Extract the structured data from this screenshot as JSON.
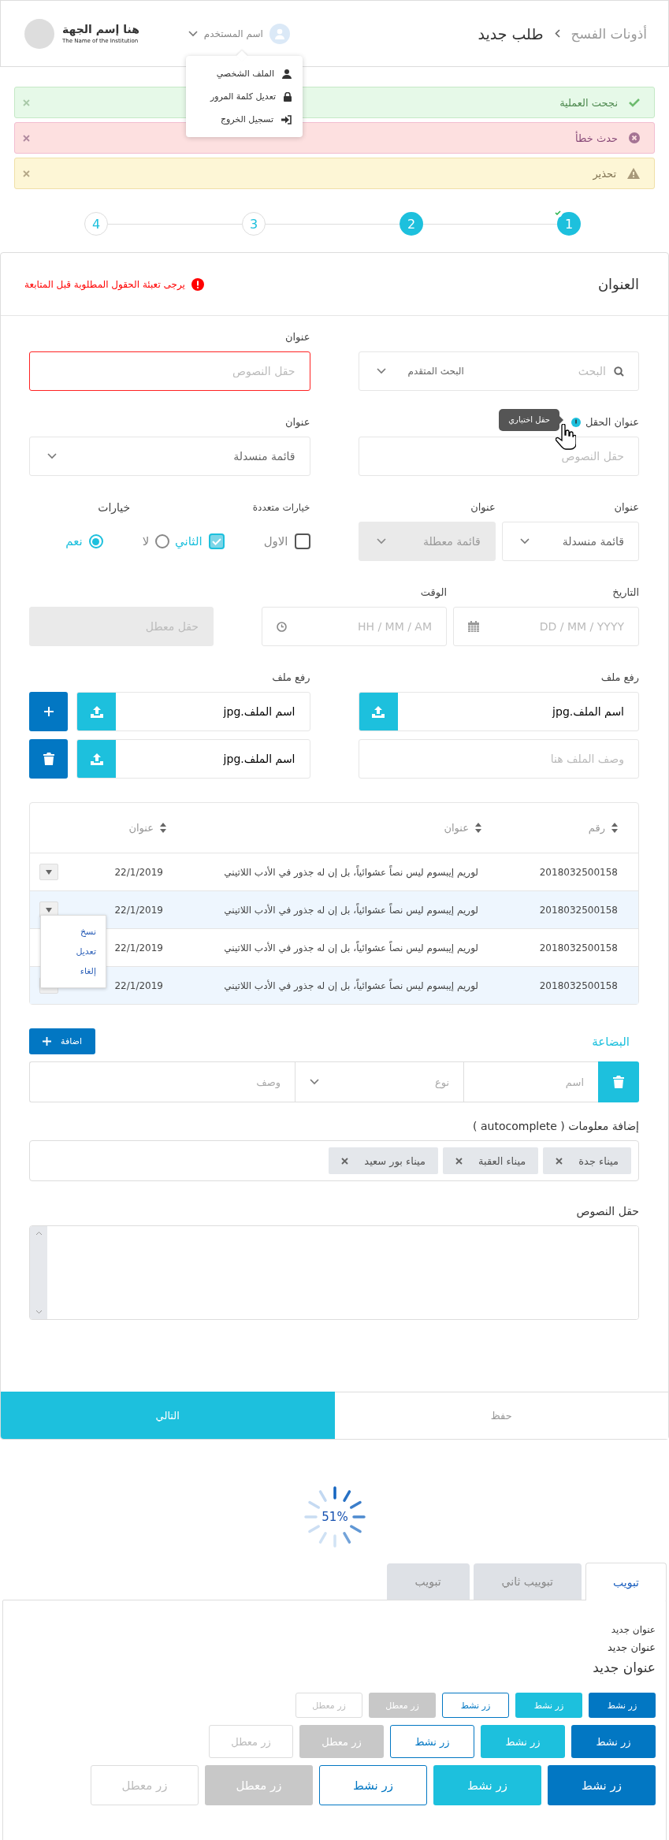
{
  "header": {
    "breadcrumb": [
      "أذونات الفسح",
      "طلب جديد"
    ],
    "user": "اسم المستخدم",
    "logo_title": "هنا إسم الجهة",
    "logo_subtitle": "The Name of the Institution"
  },
  "user_menu": [
    {
      "kind": "profile",
      "label": "الملف الشخصي"
    },
    {
      "kind": "lock",
      "label": "تعديل كلمة المرور"
    },
    {
      "kind": "logout",
      "label": "تسجيل الخروج"
    }
  ],
  "alerts": [
    {
      "kind": "success",
      "text": "نجحت العملية"
    },
    {
      "kind": "error",
      "text": "حدث خطأ"
    },
    {
      "kind": "warning",
      "text": "تحذير"
    }
  ],
  "stepper": [
    {
      "label": "1",
      "active": true,
      "completed": true
    },
    {
      "label": "2",
      "active": true,
      "completed": false
    },
    {
      "label": "3",
      "active": false,
      "completed": false
    },
    {
      "label": "4",
      "active": false,
      "completed": false
    }
  ],
  "form": {
    "title": "العنوان",
    "error": "يرجى تعبئة الحقول المطلوبة قبل المتابعة",
    "search": {
      "placeholder": "البحث",
      "filter": "البحث المتقدم"
    },
    "text_field": {
      "label": "عنوان",
      "placeholder": "حقل النصوص",
      "invalid": true
    },
    "optional_field": {
      "label": "عنوان الحقل",
      "tooltip": "حقل اختياري",
      "placeholder": "حقل النصوص"
    },
    "dropdown_1": {
      "label": "عنوان",
      "value": "قائمة منسدلة",
      "disabled": false
    },
    "dropdown_2": {
      "label": "عنوان",
      "value": "قائمة منسدلة",
      "disabled": false
    },
    "dropdown_3": {
      "label": "عنوان",
      "value": "قائمة معطلة",
      "disabled": true
    },
    "checkboxes": {
      "label": "خيارات متعددة",
      "options": [
        {
          "label": "الاول",
          "checked": false
        },
        {
          "label": "الثاني",
          "checked": true
        }
      ]
    },
    "radios": {
      "label": "خيارات",
      "options": [
        {
          "label": "لا",
          "selected": false
        },
        {
          "label": "نعم",
          "selected": true
        }
      ]
    },
    "date": {
      "label": "التاريخ",
      "placeholder": "DD / MM / YYYY"
    },
    "time": {
      "label": "الوقت",
      "placeholder": "HH / MM / AM"
    },
    "disabled_field": {
      "placeholder": "حقل معطل",
      "disabled": true
    },
    "upload": {
      "label": "رفع ملف",
      "file": "اسم الملف.jpg",
      "description_placeholder": "وصف الملف هنا"
    },
    "uploads": {
      "label": "رفع ملف",
      "files": [
        {
          "name": "اسم الملف.jpg",
          "kind": "add"
        },
        {
          "name": "اسم الملف.jpg",
          "kind": "delete"
        }
      ]
    },
    "table": {
      "columns": [
        {
          "label": "رقم",
          "sortable": true
        },
        {
          "label": "عنوان",
          "sortable": true
        },
        {
          "label": "عنوان",
          "sortable": true
        }
      ],
      "rows": [
        {
          "cells": [
            "2018032500158",
            "لوريم إيبسوم ليس نصاً عشوائياً، بل إن له جذور في الأدب اللاتيني",
            "22/1/2019"
          ],
          "highlighted": false,
          "menu_open": false
        },
        {
          "cells": [
            "2018032500158",
            "لوريم إيبسوم ليس نصاً عشوائياً، بل إن له جذور في الأدب اللاتيني",
            "22/1/2019"
          ],
          "highlighted": true,
          "menu_open": true
        },
        {
          "cells": [
            "2018032500158",
            "لوريم إيبسوم ليس نصاً عشوائياً، بل إن له جذور في الأدب اللاتيني",
            "22/1/2019"
          ],
          "highlighted": false,
          "menu_open": false
        },
        {
          "cells": [
            "2018032500158",
            "لوريم إيبسوم ليس نصاً عشوائياً، بل إن له جذور في الأدب اللاتيني",
            "22/1/2019"
          ],
          "highlighted": true,
          "menu_open": false
        }
      ],
      "row_menu": [
        "نسخ",
        "تعديل",
        "إلغاء"
      ]
    },
    "goods": {
      "title": "البضاعة",
      "add_button": "اضافة",
      "name_placeholder": "اسم",
      "type_placeholder": "نوع",
      "description_placeholder": "وصف"
    },
    "tags": {
      "label": "إضافة معلومات ( autocomplete )",
      "items": [
        "ميناء جدة",
        "ميناء العقبة",
        "ميناء بور سعيد"
      ]
    },
    "textarea": {
      "label": "حقل النصوص"
    },
    "footer": {
      "next": "التالي",
      "save": "حفظ"
    }
  },
  "spinner": {
    "label": "51%",
    "level": 0.51
  },
  "tabs": [
    {
      "label": "تبويب",
      "selected": true
    },
    {
      "label": "تبوييب ثاني",
      "selected": false
    },
    {
      "label": "تبويب",
      "selected": false
    }
  ],
  "panel": {
    "headings": [
      {
        "text": "عنوان جديد",
        "kind": "small"
      },
      {
        "text": "عنوان جديد",
        "kind": "medium"
      },
      {
        "text": "عنوان جديد",
        "kind": "large"
      }
    ],
    "button_rows": [
      {
        "kind": "small",
        "buttons": [
          {
            "label": "زر نشط",
            "kind": "primary"
          },
          {
            "label": "زر نشط",
            "kind": "secondary"
          },
          {
            "label": "زر نشط",
            "kind": "outline"
          },
          {
            "label": "زر معطل",
            "kind": "disabled"
          },
          {
            "label": "زر معطل",
            "kind": "disabled_outline"
          }
        ]
      },
      {
        "kind": "medium",
        "buttons": [
          {
            "label": "زر نشط",
            "kind": "primary"
          },
          {
            "label": "زر نشط",
            "kind": "secondary"
          },
          {
            "label": "زر نشط",
            "kind": "outline"
          },
          {
            "label": "زر معطل",
            "kind": "disabled"
          },
          {
            "label": "زر معطل",
            "kind": "disabled_outline"
          }
        ]
      },
      {
        "kind": "large",
        "buttons": [
          {
            "label": "زر نشط",
            "kind": "primary"
          },
          {
            "label": "زر نشط",
            "kind": "secondary"
          },
          {
            "label": "زر نشط",
            "kind": "outline"
          },
          {
            "label": "زر معطل",
            "kind": "disabled"
          },
          {
            "label": "زر معطل",
            "kind": "disabled_outline"
          }
        ]
      }
    ]
  }
}
